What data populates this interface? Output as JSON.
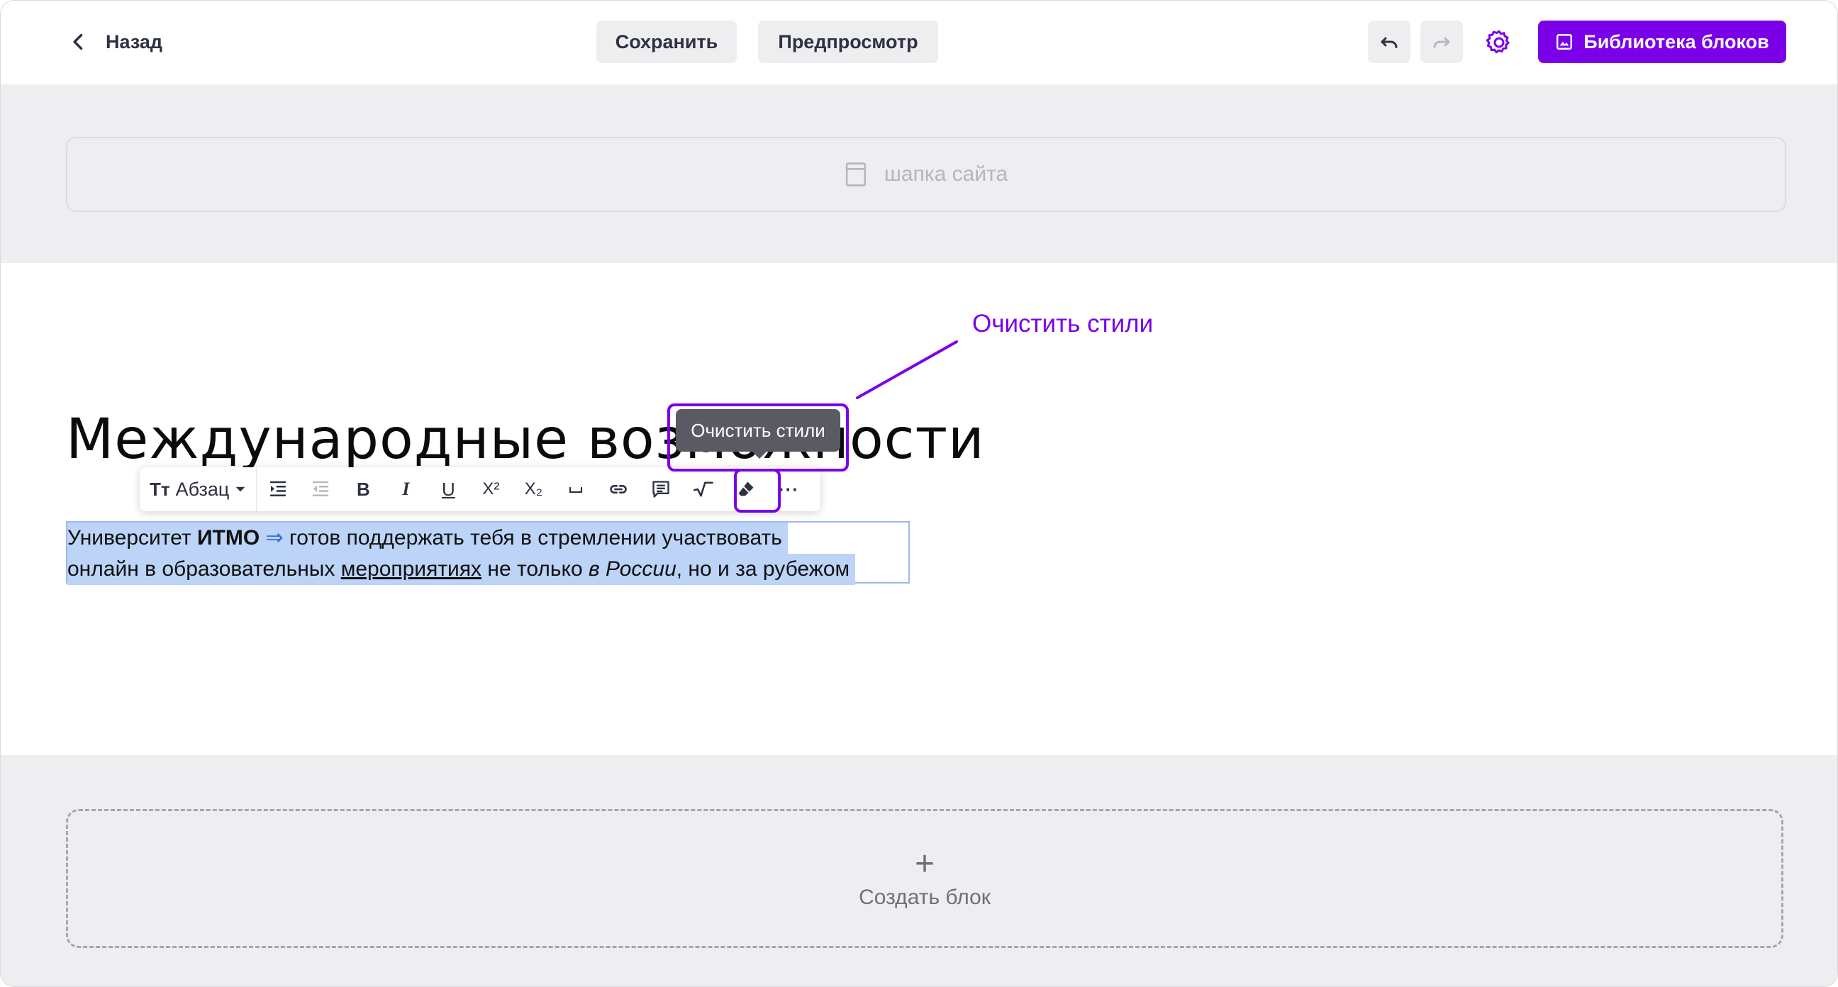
{
  "topbar": {
    "back_label": "Назад",
    "save_label": "Сохранить",
    "preview_label": "Предпросмотр",
    "library_label": "Библиотека блоков"
  },
  "header_block": {
    "label": "шапка сайта"
  },
  "content": {
    "title": "Международные возможности",
    "paragraph": {
      "line1_a": "Университет ",
      "line1_bold": "ИТМО",
      "line1_arrow": "⇒",
      "line1_b": " готов поддержать тебя в стремлении участвовать",
      "line2_a": "онлайн в образовательных ",
      "line2_underline": "мероприятиях",
      "line2_b": " не только ",
      "line2_italic": "в России",
      "line2_c": ", но и за рубежом"
    }
  },
  "toolbar": {
    "format_label": "Абзац",
    "bold": "B",
    "italic": "I",
    "underline": "U",
    "superscript": "X²",
    "subscript": "X₂",
    "more": "···",
    "tooltip": "Очистить стили"
  },
  "annotation": {
    "text": "Очистить стили"
  },
  "create_block": {
    "plus": "+",
    "label": "Создать блок"
  },
  "colors": {
    "accent": "#7b00e8",
    "selection": "#bcd4f7",
    "band": "#eeeef0"
  }
}
